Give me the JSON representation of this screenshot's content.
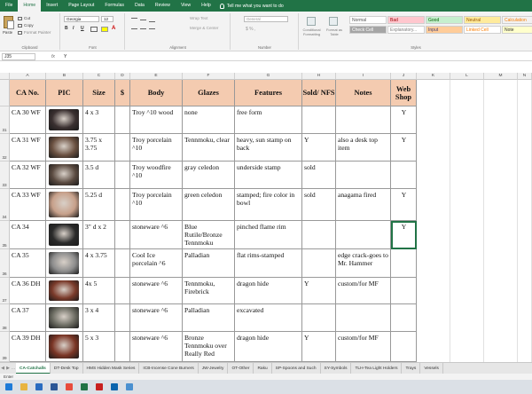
{
  "menu": {
    "tabs": [
      "File",
      "Home",
      "Insert",
      "Page Layout",
      "Formulas",
      "Data",
      "Review",
      "View",
      "Help"
    ],
    "active": "Home",
    "tell_me": "Tell me what you want to do"
  },
  "ribbon": {
    "clipboard": {
      "paste": "Paste",
      "cut": "Cut",
      "copy": "Copy",
      "format_painter": "Format Painter",
      "label": "Clipboard"
    },
    "font": {
      "name": "Georgia",
      "size": "12",
      "bold": "B",
      "italic": "I",
      "underline": "U",
      "label": "Font"
    },
    "alignment": {
      "wrap_text": "Wrap Text",
      "merge_center": "Merge & Center",
      "label": "Alignment"
    },
    "number": {
      "format": "General",
      "symbols": "$ % ,",
      "label": "Number"
    },
    "styles": {
      "conditional": "Conditional Formatting",
      "format_as_table": "Format as Table",
      "label": "Styles",
      "cells": [
        {
          "name": "Normal",
          "bg": "#ffffff",
          "fg": "#555555"
        },
        {
          "name": "Bad",
          "bg": "#ffc7ce",
          "fg": "#9c0006"
        },
        {
          "name": "Good",
          "bg": "#c6efce",
          "fg": "#006100"
        },
        {
          "name": "Neutral",
          "bg": "#ffeb9c",
          "fg": "#9c5700"
        },
        {
          "name": "Calculation",
          "bg": "#f2f2f2",
          "fg": "#fa7d00"
        },
        {
          "name": "Check Cell",
          "bg": "#a5a5a5",
          "fg": "#ffffff"
        },
        {
          "name": "Explanatory...",
          "bg": "#ffffff",
          "fg": "#7f7f7f"
        },
        {
          "name": "Input",
          "bg": "#ffcc99",
          "fg": "#3f3f76"
        },
        {
          "name": "Linked Cell",
          "bg": "#ffffff",
          "fg": "#fa7d00"
        },
        {
          "name": "Note",
          "bg": "#ffffcc",
          "fg": "#333333"
        }
      ]
    }
  },
  "formula_bar": {
    "cell_ref": "J35",
    "fx": "fx",
    "value": "Y"
  },
  "columns": [
    "A",
    "B",
    "C",
    "D",
    "E",
    "F",
    "G",
    "H",
    "I",
    "J",
    "K",
    "L",
    "M",
    "N"
  ],
  "table": {
    "headers": [
      "CA No.",
      "PIC",
      "Size",
      "$",
      "Body",
      "Glazes",
      "Features",
      "Sold/ NFS",
      "Notes",
      "Web Shop"
    ],
    "rows": [
      {
        "num": "31",
        "ca": "CA 30 WF",
        "size": "4 x 3",
        "price": "",
        "body": "Troy ^10 wood",
        "glazes": "none",
        "features": "free form",
        "sold": "",
        "notes": "",
        "web": "Y",
        "pic": "#3a3030"
      },
      {
        "num": "32",
        "ca": "CA 31 WF",
        "size": "3.75 x 3.75",
        "price": "",
        "body": "Troy porcelain ^10",
        "glazes": "Tennmoku, clear",
        "features": "heavy, sun stamp on back",
        "sold": "Y",
        "notes": "also a desk top item",
        "web": "Y",
        "pic": "#6a5040"
      },
      {
        "num": "33",
        "ca": "CA 32 WF",
        "size": "3.5 d",
        "price": "",
        "body": "Troy woodfire ^10",
        "glazes": "gray celedon",
        "features": "underside stamp",
        "sold": "sold",
        "notes": "",
        "web": "",
        "pic": "#5a4a40"
      },
      {
        "num": "34",
        "ca": "CA 33 WF",
        "size": "5.25 d",
        "price": "",
        "body": "Troy porcelain ^10",
        "glazes": "green celedon",
        "features": "stamped; fire color in bowl",
        "sold": "sold",
        "notes": "anagama fired",
        "web": "Y",
        "pic": "#c7a08a"
      },
      {
        "num": "35",
        "ca": "CA 34",
        "size": "3\" d x 2",
        "price": "",
        "body": "stoneware ^6",
        "glazes": "Blue Rutile/Bronze Tennmoku",
        "features": "pinched flame rim",
        "sold": "",
        "notes": "",
        "web": "Y",
        "pic": "#2a2a2a"
      },
      {
        "num": "36",
        "ca": "CA 35",
        "size": "4 x 3.75",
        "price": "",
        "body": "Cool Ice porcelain ^6",
        "glazes": "Palladian",
        "features": "flat rims-stamped",
        "sold": "",
        "notes": "edge crack-goes to Mr. Hammer",
        "web": "",
        "pic": "#8c8c8c"
      },
      {
        "num": "37",
        "ca": "CA 36 DH",
        "size": "4x 5",
        "price": "",
        "body": "stoneware ^6",
        "glazes": "Tennmoku, Firebrick",
        "features": "dragon hide",
        "sold": "Y",
        "notes": "custom/for MF",
        "web": "",
        "pic": "#7a3a2a"
      },
      {
        "num": "38",
        "ca": "CA 37",
        "size": "3 x 4",
        "price": "",
        "body": "stoneware ^6",
        "glazes": "Palladian",
        "features": "excavated",
        "sold": "",
        "notes": "",
        "web": "",
        "pic": "#6a6a60"
      },
      {
        "num": "39",
        "ca": "CA 39 DH",
        "size": "5 x 3",
        "price": "",
        "body": "stoneware ^6",
        "glazes": "Bronze Tennmoku over Really Red",
        "features": "dragon hide",
        "sold": "Y",
        "notes": "custom/for MF",
        "web": "",
        "pic": "#7a3525"
      }
    ]
  },
  "sheet_tabs": [
    "CA-Catchalls",
    "DT-Desk Top",
    "HMS Hidden Mask Series",
    "ICB-Incense Cone Burners",
    "JW-Jewelry",
    "OT-Other",
    "Raku",
    "SP-Spoons and Such",
    "SY-Symbols",
    "TLH-Tea Light Holders",
    "Trays",
    "Vessels"
  ],
  "active_sheet": "CA-Catchalls",
  "status": "Enter",
  "taskbar": [
    {
      "icon": "edge-icon",
      "color": "#1e7bd8"
    },
    {
      "icon": "file-explorer-icon",
      "color": "#e8b440"
    },
    {
      "icon": "mail-icon",
      "color": "#2a6cc0"
    },
    {
      "icon": "word-icon",
      "color": "#2b5797"
    },
    {
      "icon": "chrome-icon",
      "color": "#e84c3d"
    },
    {
      "icon": "excel-icon",
      "color": "#217346"
    },
    {
      "icon": "acrobat-icon",
      "color": "#c8201f"
    },
    {
      "icon": "outlook-icon",
      "color": "#0a64ad"
    },
    {
      "icon": "photos-icon",
      "color": "#4a90d0"
    }
  ]
}
